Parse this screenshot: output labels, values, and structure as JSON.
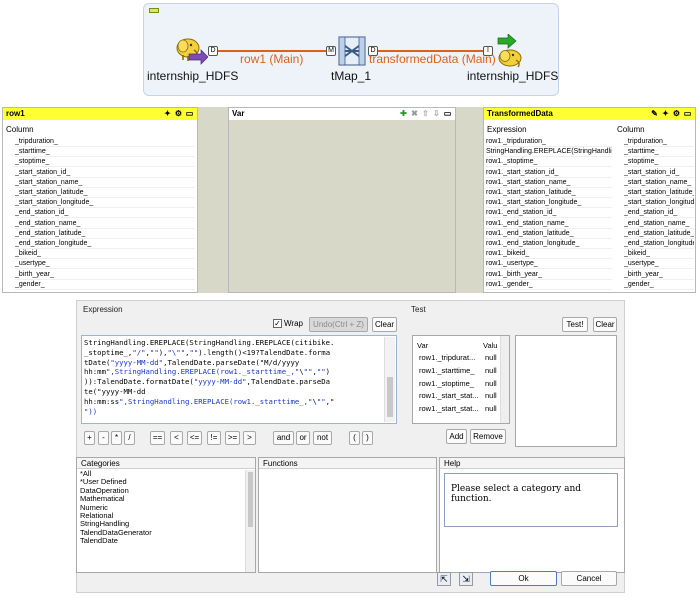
{
  "job": {
    "source_label": "internship_HDFS",
    "map_label": "tMap_1",
    "target_label": "internship_HDFS",
    "conn1_label": "row1 (Main)",
    "conn2_label": "transformedData (Main)",
    "port_d": "D",
    "port_m": "M",
    "port_i": "I"
  },
  "row1": {
    "title": "row1",
    "column_header": "Column",
    "columns": [
      "_tripduration_",
      "_starttime_",
      "_stoptime_",
      "_start_station_id_",
      "_start_station_name_",
      "_start_station_latitude_",
      "_start_station_longitude_",
      "_end_station_id_",
      "_end_station_name_",
      "_end_station_latitude_",
      "_end_station_longitude_",
      "_bikeid_",
      "_usertype_",
      "_birth_year_",
      "_gender_"
    ]
  },
  "var": {
    "title": "Var"
  },
  "transformed": {
    "title": "TransformedData",
    "expression_header": "Expression",
    "column_header": "Column",
    "expressions": [
      "row1._tripduration_",
      "StringHandling.EREPLACE(StringHandlin...",
      "row1._stoptime_",
      "row1._start_station_id_",
      "row1._start_station_name_",
      "row1._start_station_latitude_",
      "row1._start_station_longitude_",
      "row1._end_station_id_",
      "row1._end_station_name_",
      "row1._end_station_latitude_",
      "row1._end_station_longitude_",
      "row1._bikeid_",
      "row1._usertype_",
      "row1._birth_year_",
      "row1._gender_"
    ],
    "columns": [
      "_tripduration_",
      "_starttime_",
      "_stoptime_",
      "_start_station_id_",
      "_start_station_name_",
      "_start_station_latitude_",
      "_start_station_longitude_",
      "_end_station_id_",
      "_end_station_name_",
      "_end_station_latitude_",
      "_end_station_longitude_",
      "_bikeid_",
      "_usertype_",
      "_birth_year_",
      "_gender_"
    ]
  },
  "dialog": {
    "expression_title": "Expression",
    "wrap_label": "Wrap",
    "undo_label": "Undo(Ctrl + Z)",
    "clear_label": "Clear",
    "test_title": "Test",
    "test_button": "Test!",
    "test_clear": "Clear",
    "code": [
      {
        "text": "StringHandling.EREPLACE(StringHandling.EREPLACE(citibike.",
        "str": false
      },
      {
        "text": "_stoptime_,\"/\",\"\"),\"\\\"\",\"\").length()<19?TalendDate.forma",
        "str": false
      },
      {
        "text": "tDate(\"yyyy-MM-dd\",TalendDate.parseDate(\"M/d/yyyy",
        "str": false
      },
      {
        "text": "hh:mm\",StringHandling.EREPLACE(row1._starttime_,\"\\\"\",\"\")",
        "str": false
      },
      {
        "text": ")):TalendDate.formatDate(\"yyyy-MM-dd\",TalendDate.parseDa",
        "str": false
      },
      {
        "text": "te(\"yyyy-MM-dd",
        "str": false
      },
      {
        "text": "hh:mm:ss\",StringHandling.EREPLACE(row1._starttime_,\"\\\"\",\"",
        "str": false
      },
      {
        "text": "\"))",
        "str": false
      }
    ],
    "operators": [
      "+",
      "-",
      "*",
      "/",
      "==",
      "<",
      "<=",
      "!=",
      ">=",
      ">",
      "and",
      "or",
      "not",
      "(",
      ")"
    ],
    "test_var_header": "Var",
    "test_value_header": "Valu",
    "test_rows": [
      {
        "var": "row1._tripdurat...",
        "value": "null"
      },
      {
        "var": "row1._starttime_",
        "value": "null"
      },
      {
        "var": "row1._stoptime_",
        "value": "null"
      },
      {
        "var": "row1._start_stat...",
        "value": "null"
      },
      {
        "var": "row1._start_stat...",
        "value": "null"
      }
    ],
    "add_label": "Add",
    "remove_label": "Remove",
    "categories_title": "Categories",
    "categories": [
      "*All",
      "*User Defined",
      "DataOperation",
      "Mathematical",
      "Numeric",
      "Relational",
      "StringHandling",
      "TalendDataGenerator",
      "TalendDate"
    ],
    "functions_title": "Functions",
    "help_title": "Help",
    "help_text": "Please select a category and function.",
    "ok_label": "Ok",
    "cancel_label": "Cancel"
  }
}
